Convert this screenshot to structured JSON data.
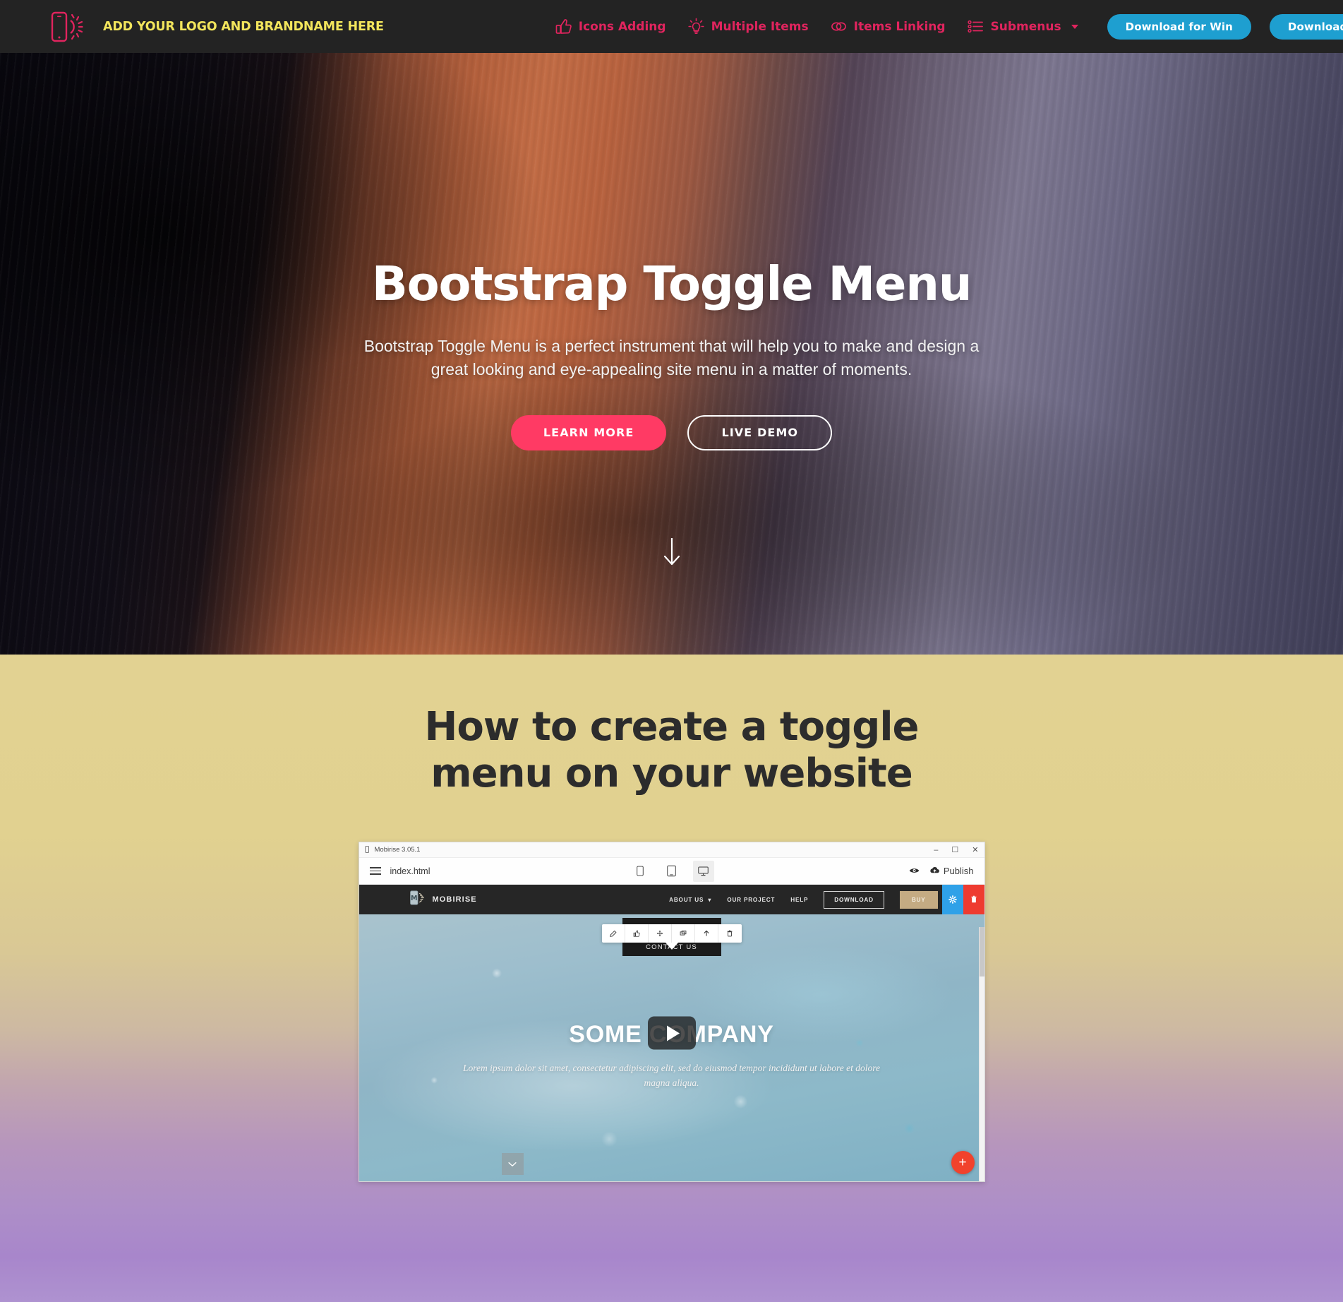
{
  "navbar": {
    "brand_name": "ADD YOUR LOGO AND BRANDNAME HERE",
    "brand_icon": "phone-sun-logo-icon",
    "accent_pink": "#e0245e",
    "brand_yellow": "#f2e55c",
    "background": "#232323",
    "links": [
      {
        "label": "Icons Adding",
        "icon": "thumbs-up-icon",
        "has_caret": false
      },
      {
        "label": "Multiple Items",
        "icon": "lightbulb-icon",
        "has_caret": false
      },
      {
        "label": "Items Linking",
        "icon": "linked-circles-icon",
        "has_caret": false
      },
      {
        "label": "Submenus",
        "icon": "bullet-list-icon",
        "has_caret": true
      }
    ],
    "buttons": [
      {
        "label": "Download for Win",
        "color": "#1e9fd0"
      },
      {
        "label": "Download for Mac",
        "color": "#1e9fd0"
      }
    ]
  },
  "hero": {
    "title": "Bootstrap Toggle Menu",
    "subtitle": "Bootstrap Toggle Menu is a perfect instrument that will help you to make and design a great looking and eye-appealing site menu in a matter of moments.",
    "primary_button": {
      "label": "LEARN MORE",
      "color": "#ff3a64"
    },
    "secondary_button": {
      "label": "LIVE DEMO",
      "color": "#ffffff"
    },
    "scroll_icon": "arrow-down-icon"
  },
  "section2": {
    "title": "How to create a toggle menu on your website",
    "gradient_top": "#e2d292",
    "gradient_bottom": "#ae92d0"
  },
  "app_preview": {
    "window_title": "Mobirise 3.05.1",
    "window_icon": "mobirise-app-icon",
    "window_controls": [
      "minimize-icon",
      "maximize-icon",
      "close-icon"
    ],
    "toolbar": {
      "menu_icon": "hamburger-icon",
      "file_name": "index.html",
      "devices": [
        {
          "icon": "phone-icon",
          "active": false
        },
        {
          "icon": "tablet-icon",
          "active": false
        },
        {
          "icon": "desktop-icon",
          "active": true
        }
      ],
      "preview_icon": "eye-icon",
      "publish_icon": "cloud-upload-icon",
      "publish_label": "Publish"
    },
    "site": {
      "brand": "MOBIRISE",
      "brand_icon": "mobirise-m-logo-icon",
      "menu": [
        {
          "label": "ABOUT US",
          "has_caret": true
        },
        {
          "label": "OUR PROJECT",
          "has_caret": false
        },
        {
          "label": "HELP",
          "has_caret": false
        }
      ],
      "download_label": "DOWNLOAD",
      "buy_label": "BUY",
      "badges": [
        {
          "icon": "gear-icon",
          "color": "#2fa1e8"
        },
        {
          "icon": "trash-icon",
          "color": "#ee3b30"
        }
      ],
      "edit_toolbar_icons": [
        "pencil-icon",
        "thumbs-up-icon",
        "move-icon",
        "duplicate-icon",
        "arrow-up-icon",
        "delete-icon"
      ],
      "contact_label": "CONTACT US",
      "hero_title": "SOME COMPANY",
      "hero_subtitle": "Lorem ipsum dolor sit amet, consectetur adipiscing elit, sed do eiusmod tempor incididunt ut labore et dolore magna aliqua.",
      "play_icon": "play-icon",
      "scroll_down_icon": "chevron-down-icon",
      "add_block_icon": "plus-icon"
    }
  }
}
